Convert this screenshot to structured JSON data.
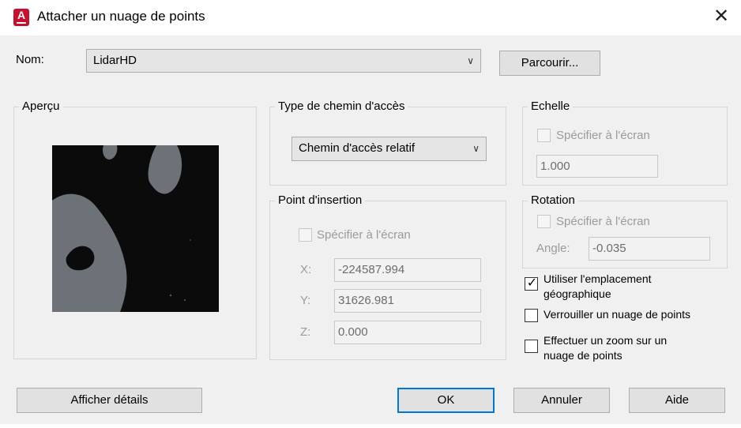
{
  "window": {
    "title": "Attacher un nuage de points",
    "icon": "autocad-icon",
    "icon_letter": "A",
    "close_glyph": "✕"
  },
  "name_row": {
    "label": "Nom:",
    "value": "LidarHD",
    "browse_label": "Parcourir..."
  },
  "preview": {
    "legend": "Aperçu"
  },
  "path_type": {
    "legend": "Type de chemin d'accès",
    "selected": "Chemin d'accès relatif"
  },
  "insertion": {
    "legend": "Point d'insertion",
    "specify_label": "Spécifier à l'écran",
    "specify_checked": false,
    "x_label": "X:",
    "x_value": "-224587.994",
    "y_label": "Y:",
    "y_value": "31626.981",
    "z_label": "Z:",
    "z_value": "0.000"
  },
  "scale": {
    "legend": "Echelle",
    "specify_label": "Spécifier à l'écran",
    "specify_checked": false,
    "value": "1.000"
  },
  "rotation": {
    "legend": "Rotation",
    "specify_label": "Spécifier à l'écran",
    "specify_checked": false,
    "angle_label": "Angle:",
    "angle_value": "-0.035"
  },
  "options": {
    "geo_label_line1": "Utiliser l'emplacement",
    "geo_label_line2": "géographique",
    "geo_checked": true,
    "lock_label": "Verrouiller un nuage de points",
    "lock_checked": false,
    "zoom_label_line1": "Effectuer un zoom sur un",
    "zoom_label_line2": "nuage de points",
    "zoom_checked": false
  },
  "buttons": {
    "details": "Afficher détails",
    "ok": "OK",
    "cancel": "Annuler",
    "help": "Aide"
  },
  "colors": {
    "accent": "#0078d7",
    "app_icon": "#c8102e",
    "dialog_bg": "#f0f0f0"
  }
}
